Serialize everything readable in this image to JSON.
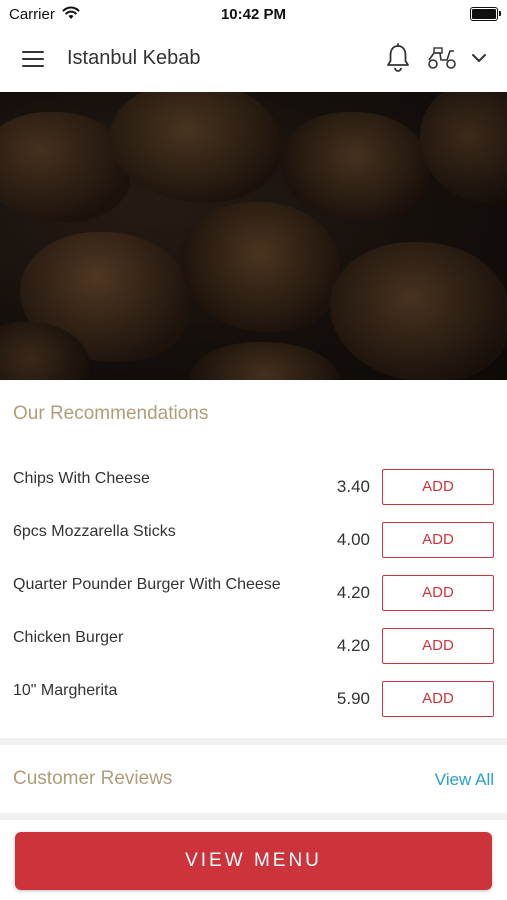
{
  "status_bar": {
    "carrier": "Carrier",
    "time": "10:42 PM"
  },
  "header": {
    "title": "Istanbul Kebab",
    "icons": [
      "menu-icon",
      "bell-icon",
      "scooter-icon",
      "chevron-down-icon"
    ]
  },
  "recommendations": {
    "title": "Our Recommendations",
    "items": [
      {
        "name": "Chips With Cheese",
        "price": "3.40",
        "button": "ADD"
      },
      {
        "name": "6pcs Mozzarella Sticks",
        "price": "4.00",
        "button": "ADD"
      },
      {
        "name": "Quarter Pounder Burger With Cheese",
        "price": "4.20",
        "button": "ADD"
      },
      {
        "name": "Chicken Burger",
        "price": "4.20",
        "button": "ADD"
      },
      {
        "name": "10\" Margherita",
        "price": "5.90",
        "button": "ADD"
      }
    ]
  },
  "reviews": {
    "title": "Customer Reviews",
    "link": "View All"
  },
  "footer": {
    "button": "VIEW MENU"
  },
  "colors": {
    "accent": "#cd333b",
    "section_title": "#b29d7a",
    "link": "#2aa0cf"
  }
}
